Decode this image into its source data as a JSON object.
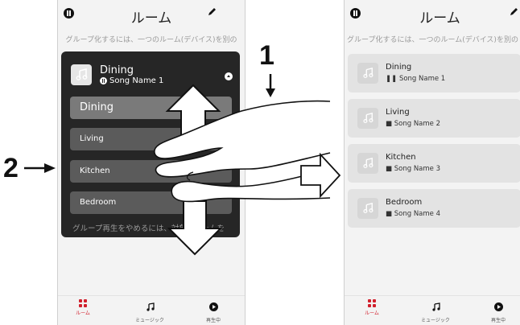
{
  "screen": {
    "title": "ルーム",
    "hint": "グループ化するには、一つのルーム(デバイス)を別の"
  },
  "left": {
    "group_header": {
      "room": "Dining",
      "song": "Song Name 1"
    },
    "rows": [
      {
        "label": "Dining"
      },
      {
        "label": "Living"
      },
      {
        "label": "Kitchen"
      },
      {
        "label": "Bedroom"
      }
    ],
    "footer_hint": "グループ再生をやめるには、対象のルームを"
  },
  "right": {
    "rooms": [
      {
        "room": "Dining",
        "song": "Song Name 1",
        "state": "paused"
      },
      {
        "room": "Living",
        "song": "Song Name 2",
        "state": "playing"
      },
      {
        "room": "Kitchen",
        "song": "Song Name 3",
        "state": "playing"
      },
      {
        "room": "Bedroom",
        "song": "Song Name 4",
        "state": "playing"
      }
    ]
  },
  "nav": {
    "items": [
      {
        "label": "ルーム",
        "icon": "rooms-grid-icon",
        "active": true
      },
      {
        "label": "ミュージック",
        "icon": "music-note-icon",
        "active": false
      },
      {
        "label": "再生中",
        "icon": "now-playing-icon",
        "active": false
      }
    ]
  },
  "annotations": {
    "step1": "1",
    "step2": "2"
  },
  "colors": {
    "accent": "#d11f2c",
    "panel": "#262626",
    "row": "#5b5b5b",
    "card": "#e3e3e3"
  }
}
